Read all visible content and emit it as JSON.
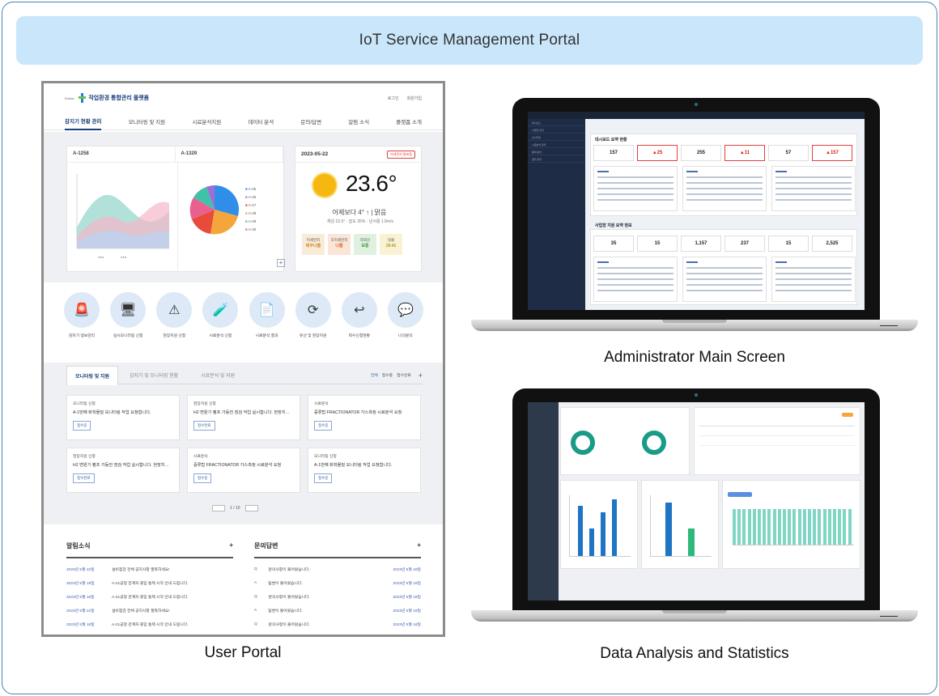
{
  "banner_title": "IoT Service Management Portal",
  "captions": {
    "user_portal": "User Portal",
    "admin": "Administrator Main Screen",
    "analysis": "Data Analysis and Statistics"
  },
  "portal": {
    "logo_sub": "Kosha",
    "logo": "작업환경 통합관리 플랫폼",
    "top_links": [
      "로그인",
      "회원가입"
    ],
    "nav": [
      "감지기 현황 관리",
      "모니터링 및 지원",
      "시료분석지원",
      "데이터 분석",
      "문의/답변",
      "알림 소식",
      "플랫폼 소개"
    ],
    "chart_headers": [
      "A-1258",
      "A-1329"
    ],
    "pie_legend": [
      "A-25",
      "A-26",
      "A-27",
      "A-28",
      "A-29",
      "A-30"
    ],
    "weather": {
      "date": "2023-05-22",
      "alert": "미세먼지 발표중",
      "temp": "23.6°",
      "line1": "어제보다 4° ↑ | 맑음",
      "line2": "체감 22.0° · 습도 35% · 남서풍 1.8m/s",
      "dust": [
        {
          "label": "미세먼지",
          "value": "매우나쁨",
          "bg": "#f8ecd9",
          "color": "#d9822b"
        },
        {
          "label": "초미세먼지",
          "value": "나쁨",
          "bg": "#fbe5d6",
          "color": "#e0652b"
        },
        {
          "label": "자외선",
          "value": "보통",
          "bg": "#e0f1e0",
          "color": "#3b9a3b"
        },
        {
          "label": "일몰",
          "value": "19:41",
          "bg": "#faf3d3",
          "color": "#b58d10"
        }
      ]
    },
    "services": [
      {
        "label": "감지기 정보관리",
        "icon": "alarm-icon"
      },
      {
        "label": "실시모니터링 신청",
        "icon": "monitor-icon"
      },
      {
        "label": "현장지원 신청",
        "icon": "warning-icon"
      },
      {
        "label": "시료분석 신청",
        "icon": "analysis-icon"
      },
      {
        "label": "시료분석 결과",
        "icon": "report-icon"
      },
      {
        "label": "유선 및 현장지원",
        "icon": "support-icon"
      },
      {
        "label": "회수신청현황",
        "icon": "return-icon"
      },
      {
        "label": "나의문의",
        "icon": "chat-icon"
      }
    ],
    "tabs": [
      "모니터링 및 지원",
      "감지기 및 모니터링 현황",
      "시료분석 및 지원"
    ],
    "tab_right": [
      "전체",
      "접수중",
      "접수완료"
    ],
    "cards": [
      {
        "cat": "모니터링 신청",
        "text": "A-1번째 화학물질 모니터링 작업 요청합니다.",
        "btn": "접수중"
      },
      {
        "cat": "현장지원 신청",
        "text": "H2 변원기 펌프 가동전 점검 작업 실시합니다. 현장지…",
        "btn": "접수완료"
      },
      {
        "cat": "시료분석",
        "text": "중류탑 FRACTIONATOR 가스측정 시료분석 요청",
        "btn": "접수중"
      },
      {
        "cat": "현장지원 신청",
        "text": "H2 변원기 펌프 가동전 점검 작업 실시합니다. 현장지…",
        "btn": "접수완료"
      },
      {
        "cat": "시료분석",
        "text": "중류탑 FRACTIONATOR 가스측정 시료분석 요청",
        "btn": "접수중"
      },
      {
        "cat": "모니터링 신청",
        "text": "A-1번째 화학물질 모니터링 작업 요청합니다.",
        "btn": "접수중"
      }
    ],
    "pager": "1 / 10",
    "notices": {
      "title": "알림소식",
      "rows": [
        {
          "date": "2023년 5월 22일",
          "text": "설비점검 전체 공지사항 필독하세요!"
        },
        {
          "date": "2023년 5월 18일",
          "text": "A-21공정 관계자 출입 통제 시작 안내 드립니다."
        },
        {
          "date": "2023년 5월 18일",
          "text": "A-21공정 관계자 출입 통제 시작 안내 드립니다."
        },
        {
          "date": "2023년 5월 22일",
          "text": "설비점검 전체 공지사항 필독하세요!"
        },
        {
          "date": "2023년 5월 18일",
          "text": "A-21공정 관계자 출입 통제 시작 안내 드립니다."
        }
      ]
    },
    "qna": {
      "title": "문의답변",
      "rows": [
        {
          "q": "Q",
          "text": "문의사항이 들어왔습니다.",
          "date": "2023년 5월 18일"
        },
        {
          "q": "A",
          "text": "답변이 들어왔습니다.",
          "date": "2023년 5월 18일"
        },
        {
          "q": "Q",
          "text": "문의사항이 들어왔습니다.",
          "date": "2023년 5월 18일"
        },
        {
          "q": "A",
          "text": "답변이 들어왔습니다.",
          "date": "2023년 5월 18일"
        },
        {
          "q": "Q",
          "text": "문의사항이 들어왔습니다.",
          "date": "2023년 5월 18일"
        }
      ]
    }
  },
  "admin": {
    "title": "대시보드 요약 현황",
    "section2": "사업장 지원 요약 정보",
    "kpis": [
      {
        "value": "157",
        "alert": false
      },
      {
        "value": "▲25",
        "alert": true
      },
      {
        "value": "255",
        "alert": false
      },
      {
        "value": "▲11",
        "alert": true
      },
      {
        "value": "57",
        "alert": false
      },
      {
        "value": "▲157",
        "alert": true
      }
    ],
    "kpis2": [
      "35",
      "15",
      "1,157",
      "237",
      "15",
      "2,525"
    ],
    "side": [
      "대시보드",
      "사업장 관리",
      "모니터링",
      "시료분석 관리",
      "통계 분석",
      "공지 관리"
    ]
  }
}
